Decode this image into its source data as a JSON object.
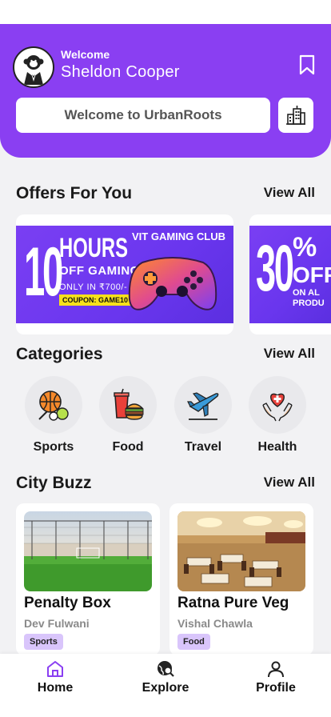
{
  "header": {
    "welcome_label": "Welcome",
    "user_name": "Sheldon Cooper",
    "search_text": "Welcome to UrbanRoots",
    "accent_color": "#8a3ff2"
  },
  "offers": {
    "title": "Offers For You",
    "view_all": "View All",
    "cards": [
      {
        "big_number": "10",
        "headline": "HOURS",
        "subline": "OFF GAMING",
        "price_line": "ONLY IN ₹700/-",
        "coupon": "COUPON: GAME10",
        "club": "VIT GAMING CLUB"
      },
      {
        "big_number": "30",
        "percent": "%",
        "off": "OFF",
        "line1": "ON AL",
        "line2": "PRODU"
      }
    ]
  },
  "categories": {
    "title": "Categories",
    "view_all": "View All",
    "items": [
      {
        "label": "Sports",
        "icon": "sports-icon"
      },
      {
        "label": "Food",
        "icon": "food-icon"
      },
      {
        "label": "Travel",
        "icon": "travel-icon"
      },
      {
        "label": "Health",
        "icon": "health-icon"
      }
    ]
  },
  "city_buzz": {
    "title": "City Buzz",
    "view_all": "View All",
    "items": [
      {
        "title": "Penalty Box",
        "author": "Dev Fulwani",
        "tag": "Sports"
      },
      {
        "title": "Ratna Pure Veg",
        "author": "Vishal Chawla",
        "tag": "Food"
      }
    ]
  },
  "nav": {
    "items": [
      {
        "label": "Home",
        "icon": "home-icon",
        "active": true
      },
      {
        "label": "Explore",
        "icon": "explore-icon",
        "active": false
      },
      {
        "label": "Profile",
        "icon": "profile-icon",
        "active": false
      }
    ]
  }
}
